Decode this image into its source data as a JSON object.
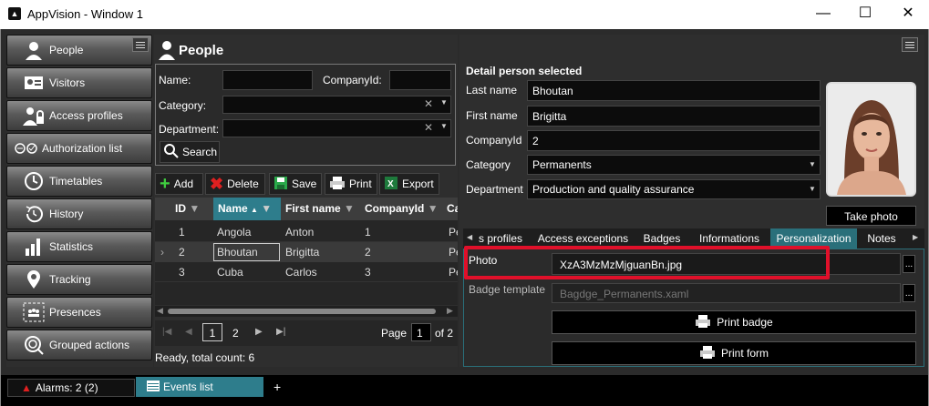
{
  "window": {
    "title": "AppVision - Window 1",
    "minimize": "—",
    "maximize": "☐",
    "close": "✕"
  },
  "sidebar": {
    "items": [
      {
        "label": "People",
        "icon": "person-icon"
      },
      {
        "label": "Visitors",
        "icon": "visitor-card-icon"
      },
      {
        "label": "Access profiles",
        "icon": "access-profiles-icon"
      },
      {
        "label": "Authorization list",
        "icon": "authorization-icon"
      },
      {
        "label": "Timetables",
        "icon": "clock-icon"
      },
      {
        "label": "History",
        "icon": "history-icon"
      },
      {
        "label": "Statistics",
        "icon": "bar-chart-icon"
      },
      {
        "label": "Tracking",
        "icon": "map-pin-icon"
      },
      {
        "label": "Presences",
        "icon": "presences-icon"
      },
      {
        "label": "Grouped actions",
        "icon": "grouped-actions-icon"
      }
    ]
  },
  "people": {
    "title": "People",
    "search": {
      "name_label": "Name:",
      "companyid_label": "CompanyId:",
      "category_label": "Category:",
      "department_label": "Department:",
      "search_button": "Search",
      "name_value": "",
      "companyid_value": ""
    },
    "toolbar": {
      "add": "Add",
      "delete": "Delete",
      "save": "Save",
      "print": "Print",
      "export": "Export"
    },
    "grid": {
      "columns": [
        "ID",
        "Name",
        "First name",
        "CompanyId",
        "Ca"
      ],
      "rows": [
        {
          "id": "1",
          "name": "Angola",
          "first": "Anton",
          "company": "1",
          "cat": "Pe"
        },
        {
          "id": "2",
          "name": "Bhoutan",
          "first": "Brigitta",
          "company": "2",
          "cat": "Pe"
        },
        {
          "id": "3",
          "name": "Cuba",
          "first": "Carlos",
          "company": "3",
          "cat": "Pe"
        }
      ]
    },
    "pager": {
      "pages": [
        "1",
        "2"
      ],
      "current": "1",
      "page_label": "Page",
      "page_value": "1",
      "of_label": "of 2"
    },
    "status": "Ready, total count: 6"
  },
  "detail": {
    "title": "Detail person selected",
    "fields": [
      {
        "label": "Last name",
        "value": "Bhoutan"
      },
      {
        "label": "First name",
        "value": "Brigitta"
      },
      {
        "label": "CompanyId",
        "value": "2"
      },
      {
        "label": "Category",
        "value": "Permanents"
      },
      {
        "label": "Department",
        "value": "Production and quality assurance"
      }
    ],
    "take_photo": "Take photo",
    "tabs": [
      "s profiles",
      "Access exceptions",
      "Badges",
      "Informations",
      "Personalization",
      "Notes"
    ],
    "active_tab": "Personalization",
    "photo_label": "Photo",
    "photo_value": "XzA3MzMzMjguanBn.jpg",
    "badge_label": "Badge template",
    "badge_value": "Bagdge_Permanents.xaml",
    "ellipsis": "...",
    "print_badge": "Print badge",
    "print_form": "Print form"
  },
  "bottom": {
    "alarms": "Alarms: 2 (2)",
    "events": "Events list",
    "add_tab": "+"
  },
  "colors": {
    "accent": "#2e7d8c",
    "highlight_border": "#e0102a",
    "selected_tab": "#2a6f7a"
  }
}
